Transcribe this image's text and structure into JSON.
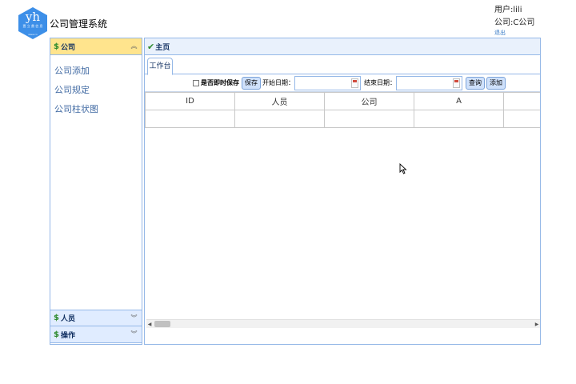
{
  "header": {
    "logo": {
      "main": "yh",
      "sub": "壹 立 鼎 信 息",
      "domain": "www.cn"
    },
    "title": "公司管理系统",
    "user_line": "用户:lili",
    "company_line": "公司:C公司",
    "logout": "退出"
  },
  "sidebar": {
    "sections": [
      {
        "label": "公司",
        "state": "expanded"
      },
      {
        "label": "人员",
        "state": "collapsed"
      },
      {
        "label": "操作",
        "state": "collapsed"
      }
    ],
    "items": [
      "公司添加",
      "公司规定",
      "公司柱状图"
    ]
  },
  "main": {
    "panel_title": "主页",
    "tabs": [
      {
        "label": "工作台"
      }
    ],
    "toolbar": {
      "checkbox_label": "是否即时保存",
      "save": "保存",
      "start_date_label": "开始日期：",
      "end_date_label": "结束日期：",
      "start_date_value": "",
      "end_date_value": "",
      "query": "查询",
      "add": "添加"
    },
    "grid": {
      "columns": [
        "ID",
        "人员",
        "公司",
        "A",
        ""
      ],
      "rows": [
        [
          "",
          "",
          "",
          "",
          ""
        ]
      ]
    }
  },
  "colors": {
    "panel_border": "#95b8e7",
    "active_header": "#ffe48d",
    "inactive_header": "#e0ecff",
    "logo": "#3d8fe8"
  }
}
